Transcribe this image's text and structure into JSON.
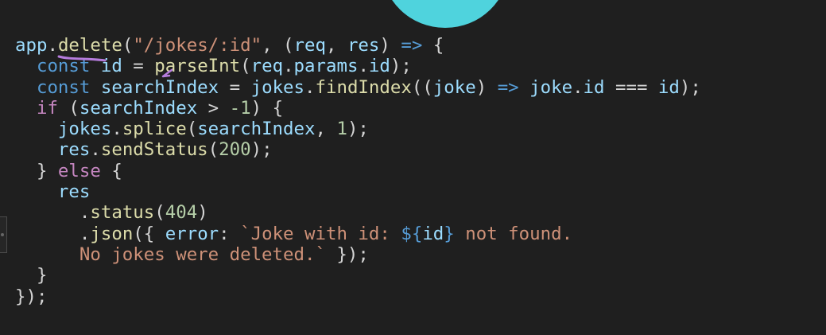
{
  "code": {
    "lines": [
      [
        {
          "t": "app",
          "c": "v"
        },
        {
          "t": ".",
          "c": "o"
        },
        {
          "t": "delete",
          "c": "f"
        },
        {
          "t": "(",
          "c": "o"
        },
        {
          "t": "\"/jokes/:id\"",
          "c": "s"
        },
        {
          "t": ", (",
          "c": "o"
        },
        {
          "t": "req",
          "c": "v"
        },
        {
          "t": ", ",
          "c": "o"
        },
        {
          "t": "res",
          "c": "v"
        },
        {
          "t": ") ",
          "c": "o"
        },
        {
          "t": "=>",
          "c": "a"
        },
        {
          "t": " {",
          "c": "o"
        }
      ],
      [
        {
          "t": "  ",
          "c": "o"
        },
        {
          "t": "const",
          "c": "k"
        },
        {
          "t": " ",
          "c": "o"
        },
        {
          "t": "id",
          "c": "v"
        },
        {
          "t": " = ",
          "c": "o"
        },
        {
          "t": "parseInt",
          "c": "f"
        },
        {
          "t": "(",
          "c": "o"
        },
        {
          "t": "req",
          "c": "v"
        },
        {
          "t": ".",
          "c": "o"
        },
        {
          "t": "params",
          "c": "v"
        },
        {
          "t": ".",
          "c": "o"
        },
        {
          "t": "id",
          "c": "v"
        },
        {
          "t": ");",
          "c": "o"
        }
      ],
      [
        {
          "t": "  ",
          "c": "o"
        },
        {
          "t": "const",
          "c": "k"
        },
        {
          "t": " ",
          "c": "o"
        },
        {
          "t": "searchIndex",
          "c": "v"
        },
        {
          "t": " = ",
          "c": "o"
        },
        {
          "t": "jokes",
          "c": "v"
        },
        {
          "t": ".",
          "c": "o"
        },
        {
          "t": "findIndex",
          "c": "f"
        },
        {
          "t": "((",
          "c": "o"
        },
        {
          "t": "joke",
          "c": "v"
        },
        {
          "t": ") ",
          "c": "o"
        },
        {
          "t": "=>",
          "c": "a"
        },
        {
          "t": " ",
          "c": "o"
        },
        {
          "t": "joke",
          "c": "v"
        },
        {
          "t": ".",
          "c": "o"
        },
        {
          "t": "id",
          "c": "v"
        },
        {
          "t": " === ",
          "c": "o"
        },
        {
          "t": "id",
          "c": "v"
        },
        {
          "t": ");",
          "c": "o"
        }
      ],
      [
        {
          "t": "  ",
          "c": "o"
        },
        {
          "t": "if",
          "c": "c"
        },
        {
          "t": " (",
          "c": "o"
        },
        {
          "t": "searchIndex",
          "c": "v"
        },
        {
          "t": " > ",
          "c": "o"
        },
        {
          "t": "-1",
          "c": "n"
        },
        {
          "t": ") {",
          "c": "o"
        }
      ],
      [
        {
          "t": "    ",
          "c": "o"
        },
        {
          "t": "jokes",
          "c": "v"
        },
        {
          "t": ".",
          "c": "o"
        },
        {
          "t": "splice",
          "c": "f"
        },
        {
          "t": "(",
          "c": "o"
        },
        {
          "t": "searchIndex",
          "c": "v"
        },
        {
          "t": ", ",
          "c": "o"
        },
        {
          "t": "1",
          "c": "n"
        },
        {
          "t": ");",
          "c": "o"
        }
      ],
      [
        {
          "t": "    ",
          "c": "o"
        },
        {
          "t": "res",
          "c": "v"
        },
        {
          "t": ".",
          "c": "o"
        },
        {
          "t": "sendStatus",
          "c": "f"
        },
        {
          "t": "(",
          "c": "o"
        },
        {
          "t": "200",
          "c": "n"
        },
        {
          "t": ");",
          "c": "o"
        }
      ],
      [
        {
          "t": "  } ",
          "c": "o"
        },
        {
          "t": "else",
          "c": "c"
        },
        {
          "t": " {",
          "c": "o"
        }
      ],
      [
        {
          "t": "    ",
          "c": "o"
        },
        {
          "t": "res",
          "c": "v"
        }
      ],
      [
        {
          "t": "      .",
          "c": "o"
        },
        {
          "t": "status",
          "c": "f"
        },
        {
          "t": "(",
          "c": "o"
        },
        {
          "t": "404",
          "c": "n"
        },
        {
          "t": ")",
          "c": "o"
        }
      ],
      [
        {
          "t": "      .",
          "c": "o"
        },
        {
          "t": "json",
          "c": "f"
        },
        {
          "t": "({ ",
          "c": "o"
        },
        {
          "t": "error",
          "c": "v"
        },
        {
          "t": ": ",
          "c": "o"
        },
        {
          "t": "`Joke with id: ",
          "c": "s"
        },
        {
          "t": "${",
          "c": "k"
        },
        {
          "t": "id",
          "c": "v"
        },
        {
          "t": "}",
          "c": "k"
        },
        {
          "t": " not found.",
          "c": "s"
        }
      ],
      [
        {
          "t": "      ",
          "c": "o"
        },
        {
          "t": "No jokes were deleted.`",
          "c": "s"
        },
        {
          "t": " });",
          "c": "o"
        }
      ],
      [
        {
          "t": "  }",
          "c": "o"
        }
      ],
      [
        {
          "t": "});",
          "c": "o"
        }
      ]
    ]
  },
  "colors": {
    "background": "#1f1f1f",
    "variable": "#9cdcfe",
    "keyword": "#569cd6",
    "control": "#c586c0",
    "function": "#dcdcaa",
    "string": "#ce9178",
    "number": "#b5cea8",
    "punctuation": "#d4d4d4",
    "annotation": "#b57cdc",
    "decoration": "#4fd3dd"
  }
}
